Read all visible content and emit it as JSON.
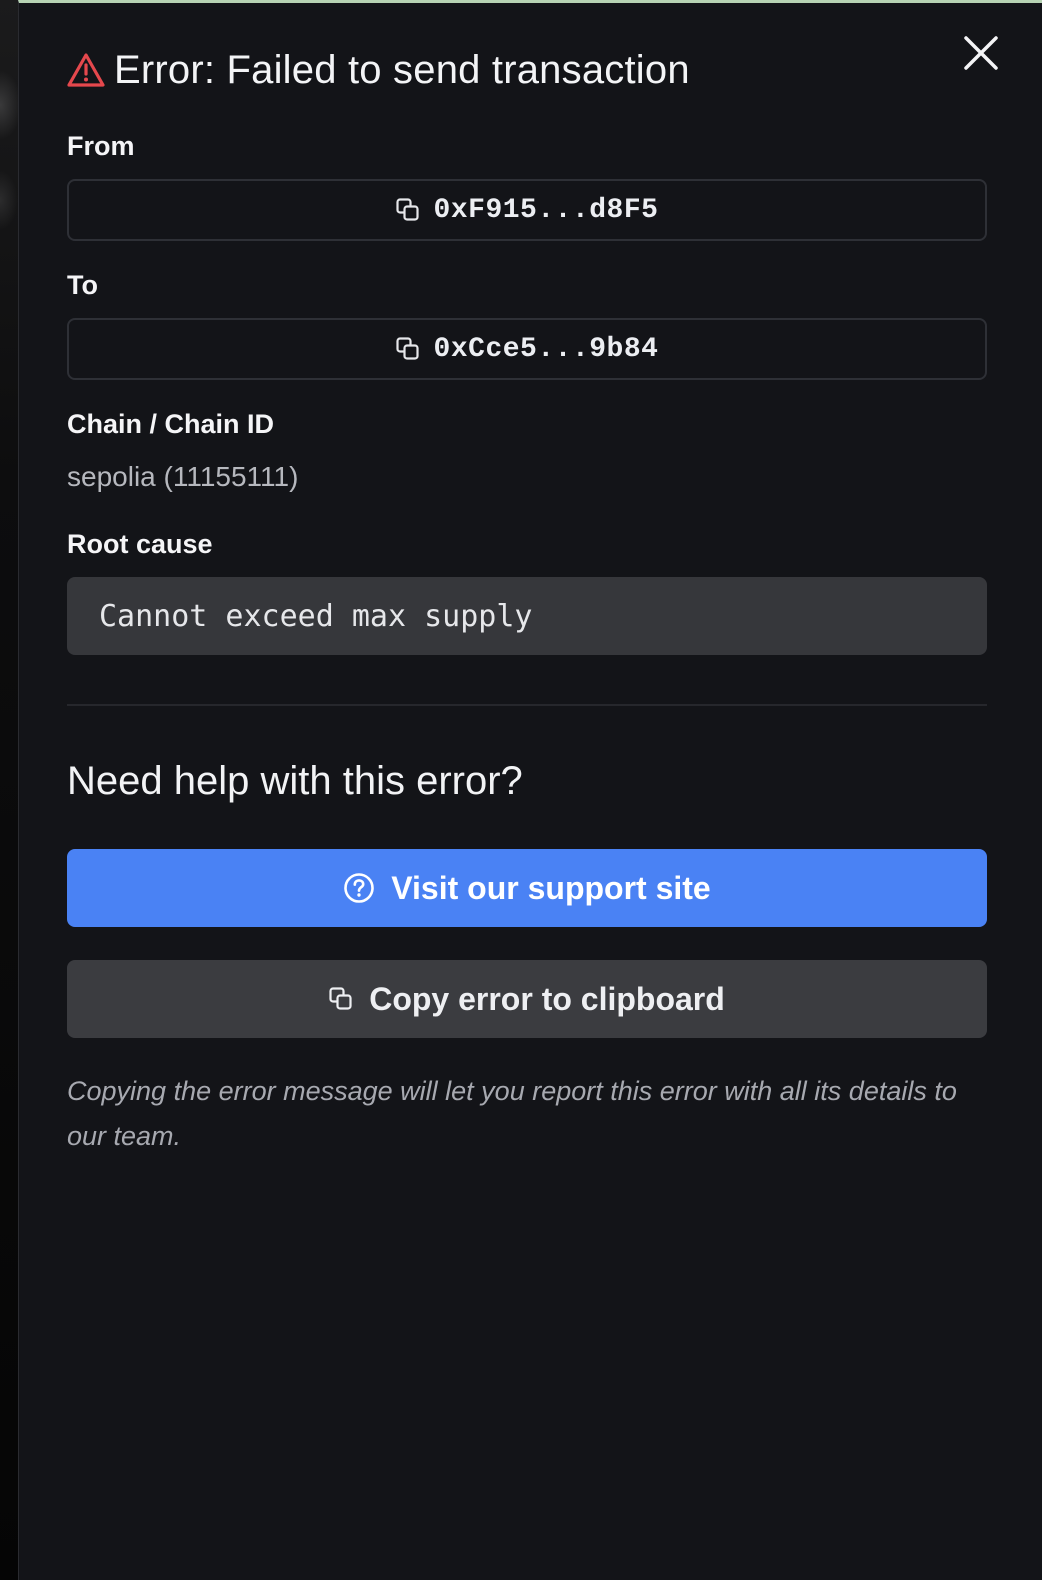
{
  "modal": {
    "title": "Error: Failed to send transaction",
    "close_icon": "close-icon",
    "warning_icon": "warning-triangle-icon",
    "colors": {
      "background": "#131418",
      "warning": "#e5484d",
      "primary_button": "#4a82f4",
      "secondary_button": "#3b3c40"
    }
  },
  "from": {
    "label": "From",
    "address": "0xF915...d8F5",
    "icon": "copy-icon"
  },
  "to": {
    "label": "To",
    "address": "0xCce5...9b84",
    "icon": "copy-icon"
  },
  "chain": {
    "label": "Chain / Chain ID",
    "value": "sepolia (11155111)"
  },
  "root_cause": {
    "label": "Root cause",
    "value": "Cannot exceed max supply"
  },
  "help": {
    "heading": "Need help with this error?",
    "support_button": "Visit our support site",
    "support_icon": "question-circle-icon",
    "copy_button": "Copy error to clipboard",
    "copy_icon": "copy-icon",
    "note": "Copying the error message will let you report this error with all its details to our team."
  }
}
